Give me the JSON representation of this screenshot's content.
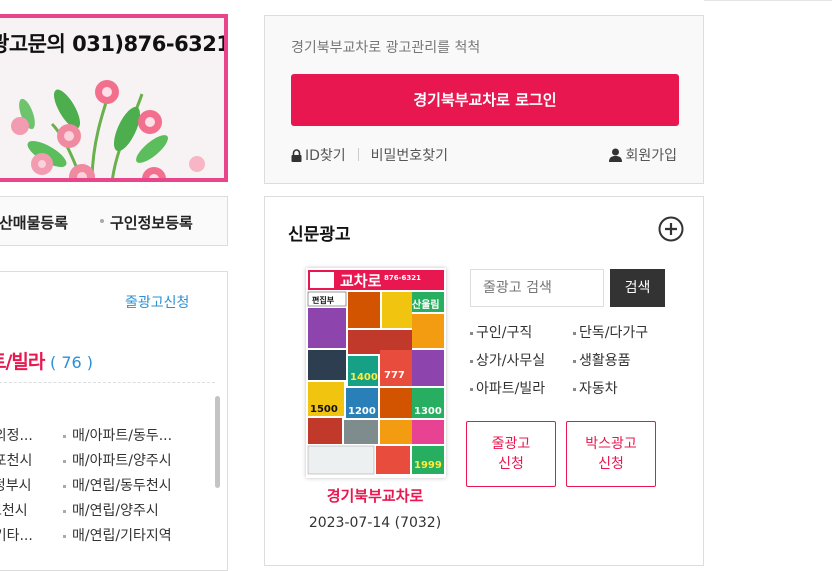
{
  "banner": {
    "phone_text": "광고문의 031)876-6321"
  },
  "register_bar": {
    "item1": "산매물등록",
    "item2": "구인정보등록"
  },
  "listing": {
    "apply_link": "줄광고신청",
    "category": "트/빌라",
    "count": "( 76 )",
    "col1": [
      "/의정...",
      "/포천시",
      "l정부시",
      "포천시",
      "/기타..."
    ],
    "col2": [
      "매/아파트/동두...",
      "매/아파트/양주시",
      "매/연립/동두천시",
      "매/연립/양주시",
      "매/연립/기타지역"
    ]
  },
  "login": {
    "notice": "경기북부교차로 광고관리를 척척",
    "button": "경기북부교차로 로그인",
    "find_id": "ID찾기",
    "find_pw": "비밀번호찾기",
    "join": "회원가입"
  },
  "newspaper": {
    "title": "신문광고",
    "name": "경기북부교차로",
    "date": "2023-07-14 (7032)",
    "search_placeholder": "줄광고 검색",
    "search_button": "검색",
    "cats_left": [
      "구인/구직",
      "상가/사무실",
      "아파트/빌라"
    ],
    "cats_right": [
      "단독/다가구",
      "생활용품",
      "자동차"
    ],
    "line_ad_btn": [
      "줄광고",
      "신청"
    ],
    "box_ad_btn": [
      "박스광고",
      "신청"
    ],
    "cover": {
      "logo": "교차로",
      "phone": "876-6321",
      "headline": "산울림",
      "tag": "편집부",
      "n1": "1400",
      "n2": "1500",
      "n3": "1200",
      "n4": "1999",
      "n5": "777",
      "n6": "1300"
    }
  },
  "colors": {
    "accent": "#e8174f",
    "link": "#2b8fd6",
    "banner_border": "#e8458b"
  }
}
